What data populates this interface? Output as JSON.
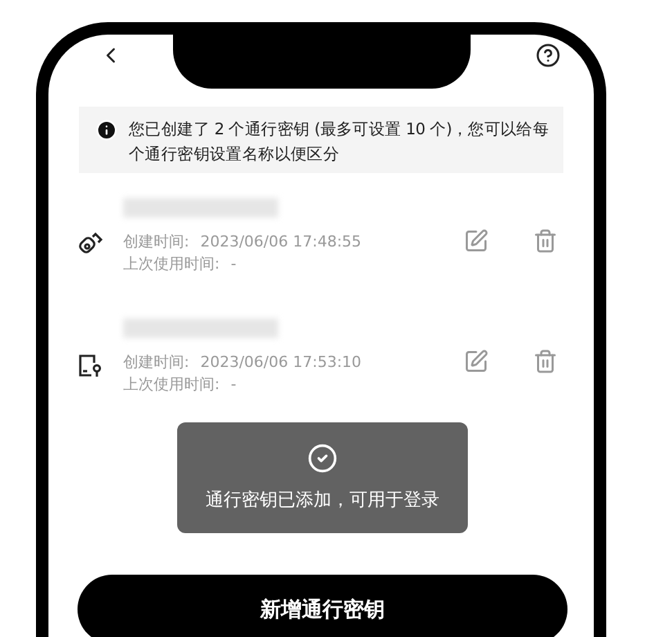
{
  "notice": {
    "text": "您已创建了 2 个通行密钥 (最多可设置 10 个)，您可以给每个通行密钥设置名称以便区分"
  },
  "passkeys": [
    {
      "kind": "usb",
      "created_label": "创建时间:",
      "created": "2023/06/06 17:48:55",
      "last_used_label": "上次使用时间:",
      "last_used": "-"
    },
    {
      "kind": "device",
      "created_label": "创建时间:",
      "created": "2023/06/06 17:53:10",
      "last_used_label": "上次使用时间:",
      "last_used": "-"
    }
  ],
  "toast": {
    "text": "通行密钥已添加，可用于登录"
  },
  "add_button": {
    "label": "新增通行密钥"
  }
}
